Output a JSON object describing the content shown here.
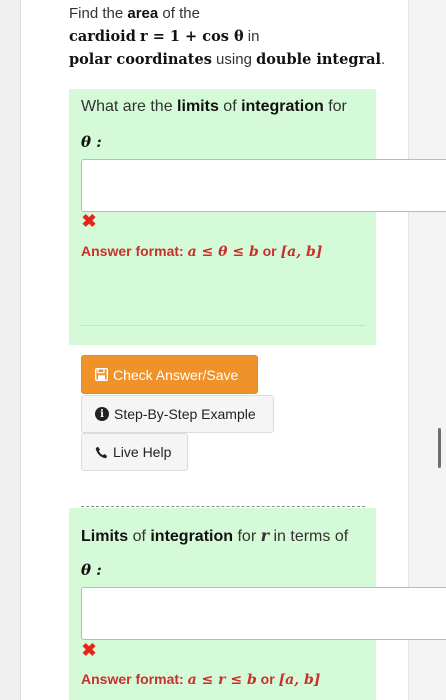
{
  "problem": {
    "line1_pre": "Find the ",
    "line1_bold": "area",
    "line1_post": " of the",
    "line2_word": "cardioid",
    "line2_math": "r = 1 + cos θ",
    "line2_post": " in",
    "line3_bold1": "polar coordinates",
    "line3_mid": " using ",
    "line3_bold2": "double integral",
    "line3_end": "."
  },
  "question1": {
    "pre": "What are the ",
    "bold1": "limits",
    "mid": " of ",
    "bold2": "integration",
    "post": " for",
    "variable": "θ :",
    "input_value": "",
    "error_mark": "✖",
    "format_label": "Answer format: ",
    "format_math": "a ≤ θ ≤ b",
    "format_or": " or ",
    "format_interval": "[a, b]"
  },
  "buttons": {
    "check_label": "Check Answer/Save",
    "step_label": "Step-By-Step Example",
    "live_label": "Live Help"
  },
  "question2": {
    "bold1": "Limits",
    "mid": " of ",
    "bold2": "integration",
    "post1": " for ",
    "var_r": "r",
    "post2": " in terms of",
    "variable": "θ :",
    "input_value": "",
    "error_mark": "✖",
    "format_label": "Answer format: ",
    "format_math": "a ≤ r ≤ b",
    "format_or": " or ",
    "format_interval": "[a, b]"
  },
  "colors": {
    "panel_green": "#d5fad7",
    "check_button": "#f0922a",
    "error_red": "#e8231c",
    "format_red": "#c9302c"
  },
  "icons": {
    "save": "save-icon",
    "info": "info-circle-icon",
    "phone": "phone-icon",
    "error": "x-mark-icon"
  }
}
